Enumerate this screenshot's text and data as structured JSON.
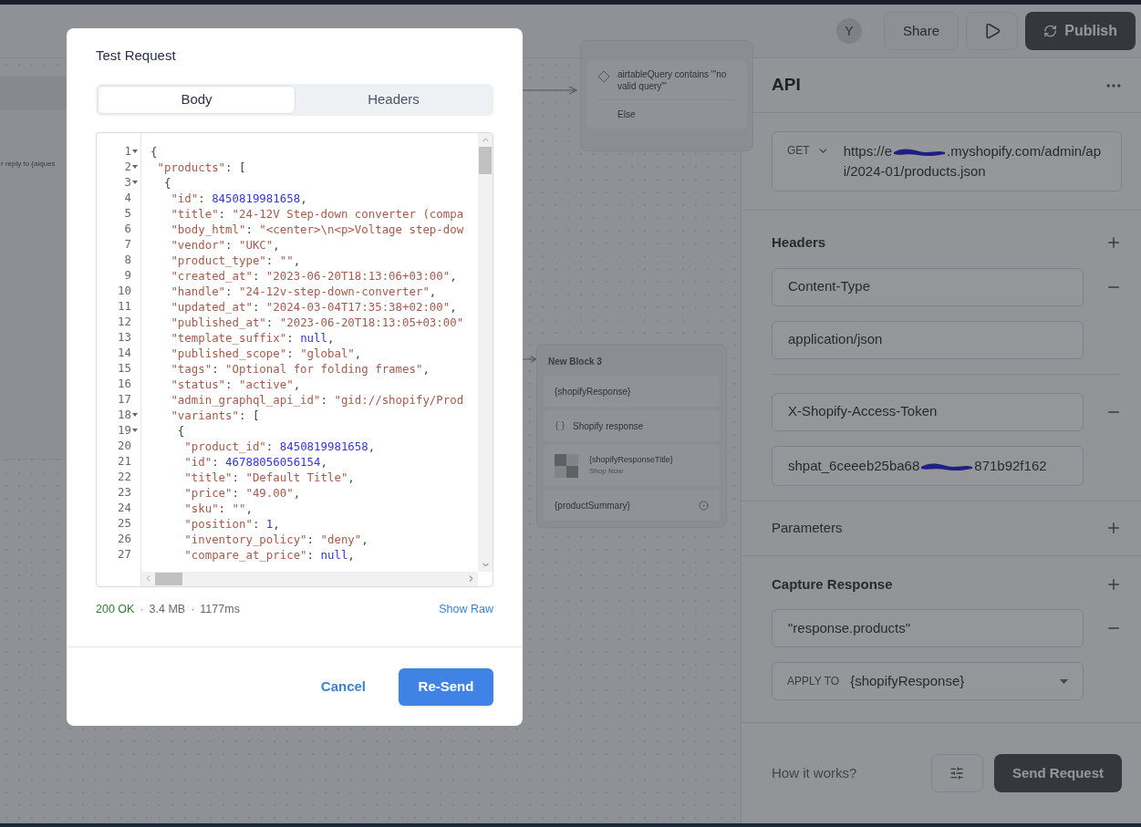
{
  "top_bar": {
    "avatar": "Y",
    "share": "Share",
    "publish": "Publish"
  },
  "canvas": {
    "left_node_text": "r reply to {aiques",
    "condition_block": {
      "items": [
        {
          "kind": "condition",
          "text": "airtableQuery contains '\"no valid query\"'"
        },
        {
          "kind": "plain",
          "text": "Else"
        }
      ]
    },
    "block": {
      "title": "New Block 3",
      "items": [
        {
          "kind": "text",
          "text": "{shopifyResponse}"
        },
        {
          "kind": "variable",
          "text": "Shopify response"
        },
        {
          "kind": "card",
          "text": "{shopifyResponseTitle}",
          "subtitle": "Shop Now"
        },
        {
          "kind": "input",
          "text": "{productSummary}"
        }
      ]
    }
  },
  "api_panel": {
    "title": "API",
    "method": "GET",
    "url_start": "https://e",
    "url_end": ".myshopify.com/admin/api/2024-01/products.json",
    "headers_label": "Headers",
    "headers": [
      {
        "key": "Content-Type",
        "value": "application/json"
      },
      {
        "key": "X-Shopify-Access-Token",
        "value_start": "shpat_6ceeeb25ba68",
        "value_end": "871b92f162"
      }
    ],
    "parameters_label": "Parameters",
    "capture_label": "Capture Response",
    "capture_value": "\"response.products\"",
    "apply_to_label": "APPLY TO",
    "apply_to_value": "{shopifyResponse}",
    "how_it_works": "How it works?",
    "send": "Send Request"
  },
  "modal": {
    "title": "Test Request",
    "tabs": [
      {
        "label": "Body",
        "selected": true
      },
      {
        "label": "Headers",
        "selected": false
      }
    ],
    "code_lines": [
      {
        "n": "1",
        "fold": true,
        "parts": [
          {
            "kind": "punct",
            "text": "{"
          }
        ]
      },
      {
        "n": "2",
        "fold": true,
        "parts": [
          {
            "kind": "string",
            "text": " \"products\""
          },
          {
            "kind": "punct",
            "text": ": ["
          }
        ]
      },
      {
        "n": "3",
        "fold": true,
        "parts": [
          {
            "kind": "punct",
            "text": "  {"
          }
        ]
      },
      {
        "n": "4",
        "fold": false,
        "parts": [
          {
            "kind": "string",
            "text": "   \"id\""
          },
          {
            "kind": "punct",
            "text": ": "
          },
          {
            "kind": "number",
            "text": "8450819981658"
          },
          {
            "kind": "punct",
            "text": ","
          }
        ]
      },
      {
        "n": "5",
        "fold": false,
        "parts": [
          {
            "kind": "string",
            "text": "   \"title\""
          },
          {
            "kind": "punct",
            "text": ": "
          },
          {
            "kind": "string",
            "text": "\"24-12V Step-down converter (compa"
          }
        ]
      },
      {
        "n": "6",
        "fold": false,
        "parts": [
          {
            "kind": "string",
            "text": "   \"body_html\""
          },
          {
            "kind": "punct",
            "text": ": "
          },
          {
            "kind": "string",
            "text": "\"<center>\\n<p>Voltage step-dow"
          }
        ]
      },
      {
        "n": "7",
        "fold": false,
        "parts": [
          {
            "kind": "string",
            "text": "   \"vendor\""
          },
          {
            "kind": "punct",
            "text": ": "
          },
          {
            "kind": "string",
            "text": "\"UKC\""
          },
          {
            "kind": "punct",
            "text": ","
          }
        ]
      },
      {
        "n": "8",
        "fold": false,
        "parts": [
          {
            "kind": "string",
            "text": "   \"product_type\""
          },
          {
            "kind": "punct",
            "text": ": "
          },
          {
            "kind": "string",
            "text": "\"\""
          },
          {
            "kind": "punct",
            "text": ","
          }
        ]
      },
      {
        "n": "9",
        "fold": false,
        "parts": [
          {
            "kind": "string",
            "text": "   \"created_at\""
          },
          {
            "kind": "punct",
            "text": ": "
          },
          {
            "kind": "string",
            "text": "\"2023-06-20T18:13:06+03:00\""
          },
          {
            "kind": "punct",
            "text": ","
          }
        ]
      },
      {
        "n": "10",
        "fold": false,
        "parts": [
          {
            "kind": "string",
            "text": "   \"handle\""
          },
          {
            "kind": "punct",
            "text": ": "
          },
          {
            "kind": "string",
            "text": "\"24-12v-step-down-converter\""
          },
          {
            "kind": "punct",
            "text": ","
          }
        ]
      },
      {
        "n": "11",
        "fold": false,
        "parts": [
          {
            "kind": "string",
            "text": "   \"updated_at\""
          },
          {
            "kind": "punct",
            "text": ": "
          },
          {
            "kind": "string",
            "text": "\"2024-03-04T17:35:38+02:00\""
          },
          {
            "kind": "punct",
            "text": ","
          }
        ]
      },
      {
        "n": "12",
        "fold": false,
        "parts": [
          {
            "kind": "string",
            "text": "   \"published_at\""
          },
          {
            "kind": "punct",
            "text": ": "
          },
          {
            "kind": "string",
            "text": "\"2023-06-20T18:13:05+03:00\""
          }
        ]
      },
      {
        "n": "13",
        "fold": false,
        "parts": [
          {
            "kind": "string",
            "text": "   \"template_suffix\""
          },
          {
            "kind": "punct",
            "text": ": "
          },
          {
            "kind": "number",
            "text": "null"
          },
          {
            "kind": "punct",
            "text": ","
          }
        ]
      },
      {
        "n": "14",
        "fold": false,
        "parts": [
          {
            "kind": "string",
            "text": "   \"published_scope\""
          },
          {
            "kind": "punct",
            "text": ": "
          },
          {
            "kind": "string",
            "text": "\"global\""
          },
          {
            "kind": "punct",
            "text": ","
          }
        ]
      },
      {
        "n": "15",
        "fold": false,
        "parts": [
          {
            "kind": "string",
            "text": "   \"tags\""
          },
          {
            "kind": "punct",
            "text": ": "
          },
          {
            "kind": "string",
            "text": "\"Optional for folding frames\""
          },
          {
            "kind": "punct",
            "text": ","
          }
        ]
      },
      {
        "n": "16",
        "fold": false,
        "parts": [
          {
            "kind": "string",
            "text": "   \"status\""
          },
          {
            "kind": "punct",
            "text": ": "
          },
          {
            "kind": "string",
            "text": "\"active\""
          },
          {
            "kind": "punct",
            "text": ","
          }
        ]
      },
      {
        "n": "17",
        "fold": false,
        "parts": [
          {
            "kind": "string",
            "text": "   \"admin_graphql_api_id\""
          },
          {
            "kind": "punct",
            "text": ": "
          },
          {
            "kind": "string",
            "text": "\"gid://shopify/Prod"
          }
        ]
      },
      {
        "n": "18",
        "fold": true,
        "parts": [
          {
            "kind": "string",
            "text": "   \"variants\""
          },
          {
            "kind": "punct",
            "text": ": ["
          }
        ]
      },
      {
        "n": "19",
        "fold": true,
        "parts": [
          {
            "kind": "punct",
            "text": "    {"
          }
        ]
      },
      {
        "n": "20",
        "fold": false,
        "parts": [
          {
            "kind": "string",
            "text": "     \"product_id\""
          },
          {
            "kind": "punct",
            "text": ": "
          },
          {
            "kind": "number",
            "text": "8450819981658"
          },
          {
            "kind": "punct",
            "text": ","
          }
        ]
      },
      {
        "n": "21",
        "fold": false,
        "parts": [
          {
            "kind": "string",
            "text": "     \"id\""
          },
          {
            "kind": "punct",
            "text": ": "
          },
          {
            "kind": "number",
            "text": "46788056056154"
          },
          {
            "kind": "punct",
            "text": ","
          }
        ]
      },
      {
        "n": "22",
        "fold": false,
        "parts": [
          {
            "kind": "string",
            "text": "     \"title\""
          },
          {
            "kind": "punct",
            "text": ": "
          },
          {
            "kind": "string",
            "text": "\"Default Title\""
          },
          {
            "kind": "punct",
            "text": ","
          }
        ]
      },
      {
        "n": "23",
        "fold": false,
        "parts": [
          {
            "kind": "string",
            "text": "     \"price\""
          },
          {
            "kind": "punct",
            "text": ": "
          },
          {
            "kind": "string",
            "text": "\"49.00\""
          },
          {
            "kind": "punct",
            "text": ","
          }
        ]
      },
      {
        "n": "24",
        "fold": false,
        "parts": [
          {
            "kind": "string",
            "text": "     \"sku\""
          },
          {
            "kind": "punct",
            "text": ": "
          },
          {
            "kind": "string",
            "text": "\"\""
          },
          {
            "kind": "punct",
            "text": ","
          }
        ]
      },
      {
        "n": "25",
        "fold": false,
        "parts": [
          {
            "kind": "string",
            "text": "     \"position\""
          },
          {
            "kind": "punct",
            "text": ": "
          },
          {
            "kind": "number",
            "text": "1"
          },
          {
            "kind": "punct",
            "text": ","
          }
        ]
      },
      {
        "n": "26",
        "fold": false,
        "parts": [
          {
            "kind": "string",
            "text": "     \"inventory_policy\""
          },
          {
            "kind": "punct",
            "text": ": "
          },
          {
            "kind": "string",
            "text": "\"deny\""
          },
          {
            "kind": "punct",
            "text": ","
          }
        ]
      },
      {
        "n": "27",
        "fold": false,
        "parts": [
          {
            "kind": "string",
            "text": "     \"compare_at_price\""
          },
          {
            "kind": "punct",
            "text": ": "
          },
          {
            "kind": "number",
            "text": "null"
          },
          {
            "kind": "punct",
            "text": ","
          }
        ]
      }
    ],
    "status": "200 OK",
    "size": "3.4 MB",
    "time": "1177ms",
    "separator": "·",
    "show_raw": "Show Raw",
    "cancel": "Cancel",
    "resend": "Re-Send"
  }
}
